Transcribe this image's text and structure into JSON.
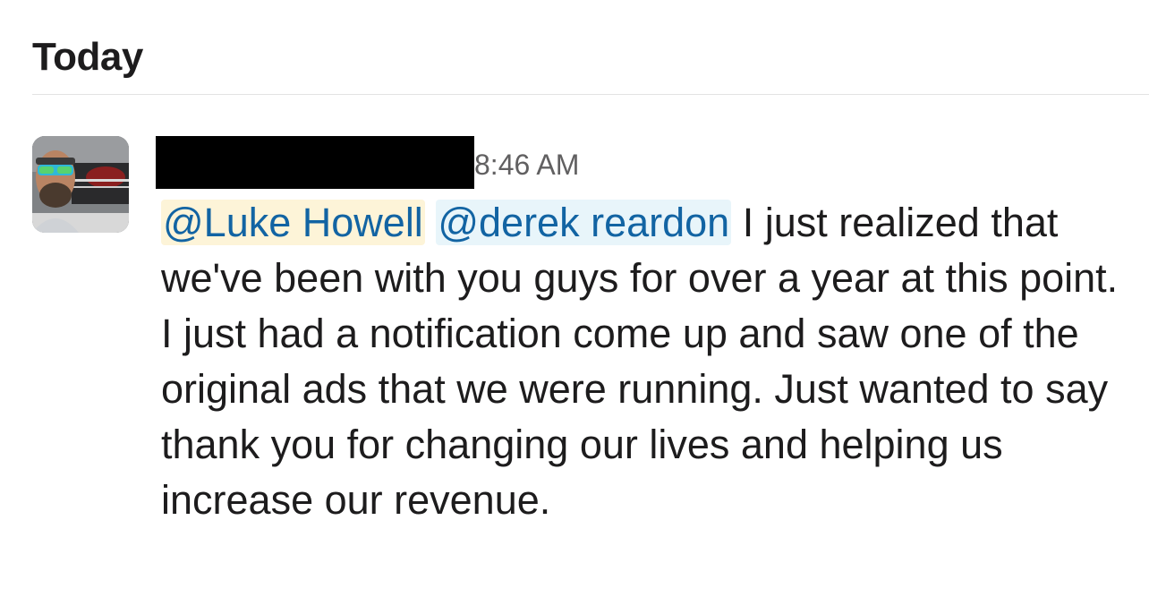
{
  "day_header": "Today",
  "message": {
    "timestamp": "8:46 AM",
    "mention_1": "@Luke Howell",
    "mention_2": "@derek reardon",
    "text": " I just realized that we've been with you guys for over a year at this point. I just had a notification come up and saw one of the original ads that we were running. Just wanted to say thank you for changing our lives and helping us increase our revenue."
  },
  "avatar": {
    "icon": "user-photo-avatar"
  },
  "colors": {
    "mention_text": "#1264a3",
    "mention_self_bg": "#fdf4d8",
    "mention_other_bg": "#e8f5fa",
    "timestamp": "#616061",
    "body_text": "#1d1c1d"
  }
}
